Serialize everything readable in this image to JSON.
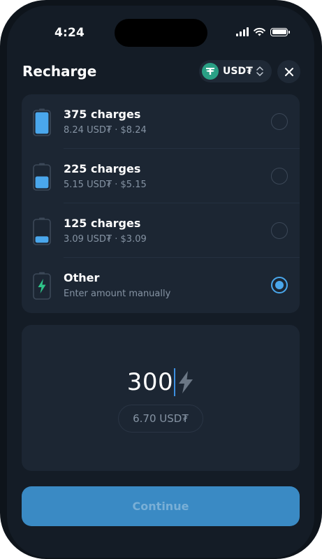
{
  "status_bar": {
    "time": "4:24"
  },
  "header": {
    "title": "Recharge",
    "currency": {
      "label": "USD₮",
      "icon": "tether-logo-icon"
    },
    "close_icon": "close-icon"
  },
  "options": [
    {
      "title": "375 charges",
      "subtitle": "8.24 USD₮ · $8.24",
      "battery_level": 1.0,
      "selected": false
    },
    {
      "title": "225 charges",
      "subtitle": "5.15 USD₮ · $5.15",
      "battery_level": 0.55,
      "selected": false
    },
    {
      "title": "125 charges",
      "subtitle": "3.09 USD₮ · $3.09",
      "battery_level": 0.3,
      "selected": false
    },
    {
      "title": "Other",
      "subtitle": "Enter amount manually",
      "icon": "lightning-icon",
      "selected": true
    }
  ],
  "amount": {
    "value": "300",
    "icon": "lightning-icon",
    "converted": "6.70 USD₮"
  },
  "continue_label": "Continue",
  "colors": {
    "background": "#141c26",
    "card": "#1c2633",
    "accent": "#4aa7ec",
    "battery_fill": "#4aa7ec",
    "lightning": "#2fc58a",
    "continue_button": "#3a8ac4"
  }
}
